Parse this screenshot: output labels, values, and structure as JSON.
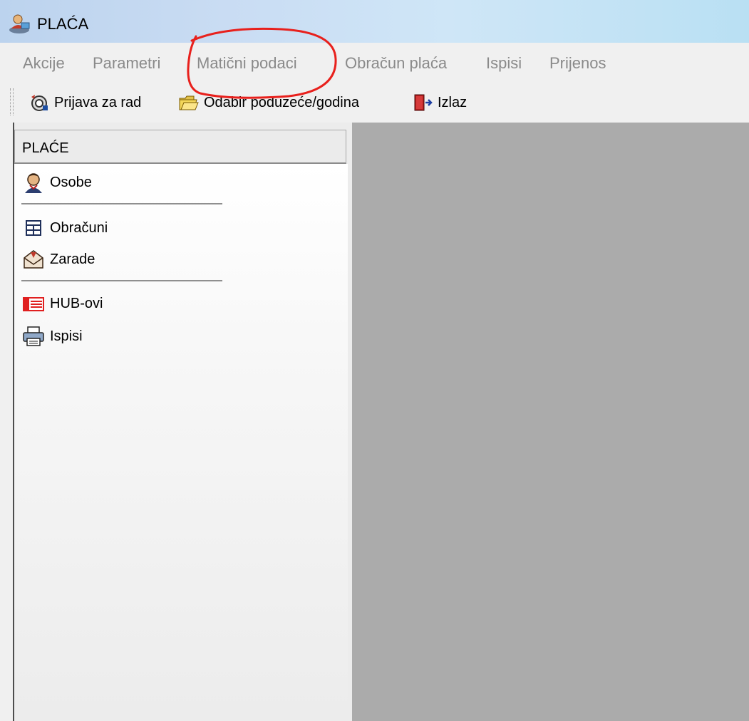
{
  "window": {
    "title": "PLAĆA",
    "icon": "app-payroll-icon"
  },
  "menu": {
    "items": [
      "Akcije",
      "Parametri",
      "Matični podaci",
      "Obračun plaća",
      "Ispisi",
      "Prijenos"
    ]
  },
  "toolbar": {
    "buttons": [
      {
        "label": "Prijava za rad",
        "icon": "login-icon"
      },
      {
        "label": "Odabir poduzeće/godina",
        "icon": "folder-open-icon"
      },
      {
        "label": "Izlaz",
        "icon": "exit-door-icon"
      }
    ]
  },
  "nav": {
    "header": "PLAĆE",
    "items": [
      {
        "label": "Osobe",
        "icon": "person-icon"
      },
      {
        "label": "Obračuni",
        "icon": "calculator-icon"
      },
      {
        "label": "Zarade",
        "icon": "envelope-icon"
      },
      {
        "label": "HUB-ovi",
        "icon": "form-icon"
      },
      {
        "label": "Ispisi",
        "icon": "printer-icon"
      }
    ]
  },
  "colors": {
    "annotation": "#e8201c",
    "workspace": "#ababab",
    "menu_disabled_text": "#8a8a8a"
  }
}
